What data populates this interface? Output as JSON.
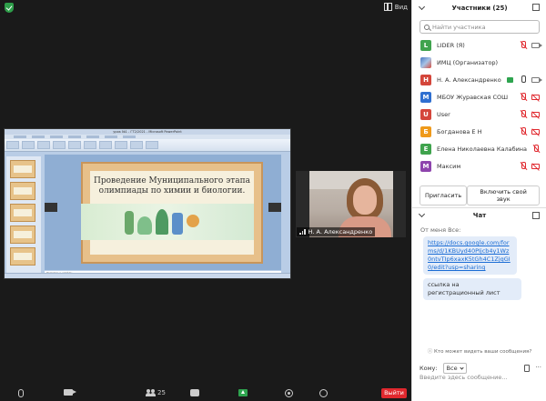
{
  "meeting": {
    "view_label": "Вид",
    "video_name": "Н. А. Александренко"
  },
  "slide": {
    "window_title": "урок №1 - ГТ2/2021 - Microsoft PowerPoint",
    "title": "Проведение Муниципального этапа олимпиады по химии и биологии.",
    "notes_placeholder": "Заметки к слайду"
  },
  "toolbar": {
    "participants_count": "25",
    "leave_label": "Выйти"
  },
  "participants_panel": {
    "title": "Участники (25)",
    "search_placeholder": "Найти участника",
    "participants": [
      {
        "initial": "L",
        "color": "#3fa34d",
        "name": "LIDER (Я)",
        "mic": "off",
        "cam": "on",
        "avatar_type": "letter"
      },
      {
        "initial": "",
        "color": "#4a78c0",
        "name": "ИМЦ (Организатор)",
        "mic": "none",
        "cam": "none",
        "avatar_type": "image"
      },
      {
        "initial": "Н",
        "color": "#d4463b",
        "name": "Н. А. Александренко",
        "mic": "on",
        "cam": "on",
        "avatar_type": "letter",
        "sharing": true
      },
      {
        "initial": "М",
        "color": "#2f6fd0",
        "name": "МБОУ Журавская СОШ",
        "mic": "off",
        "cam": "off",
        "avatar_type": "letter"
      },
      {
        "initial": "U",
        "color": "#d4463b",
        "name": "User",
        "mic": "off",
        "cam": "off",
        "avatar_type": "letter"
      },
      {
        "initial": "Б",
        "color": "#ef9a1b",
        "name": "Богданова Е Н",
        "mic": "off",
        "cam": "off",
        "avatar_type": "letter"
      },
      {
        "initial": "Е",
        "color": "#3fa34d",
        "name": "Елена Николаевна Калабина",
        "mic": "off",
        "cam": "none",
        "avatar_type": "letter"
      },
      {
        "initial": "М",
        "color": "#8e44ad",
        "name": "Максим",
        "mic": "off",
        "cam": "off",
        "avatar_type": "letter"
      }
    ],
    "invite_label": "Пригласить",
    "unmute_label": "Включить свой звук"
  },
  "chat": {
    "title": "Чат",
    "from_line": "От меня Все:",
    "messages": [
      {
        "text": "https://docs.google.com/forms/d/1KBUyd40PIjcb4y1Wz0ntvTIp6xaxK5tGh4C1ZjqGI0/edit?usp=sharing",
        "is_link": true
      },
      {
        "text": "ссылка на регистрационный лист",
        "is_link": false
      }
    ],
    "who_can_see": "Кто может видеть ваши сообщения?",
    "to_label": "Кому:",
    "to_value": "Все",
    "input_placeholder": "Введите здесь сообщение..."
  },
  "colors": {
    "leave": "#e0282e",
    "share": "#2ea44f",
    "link": "#1a6cd4",
    "bubble": "#e3ecf9"
  }
}
